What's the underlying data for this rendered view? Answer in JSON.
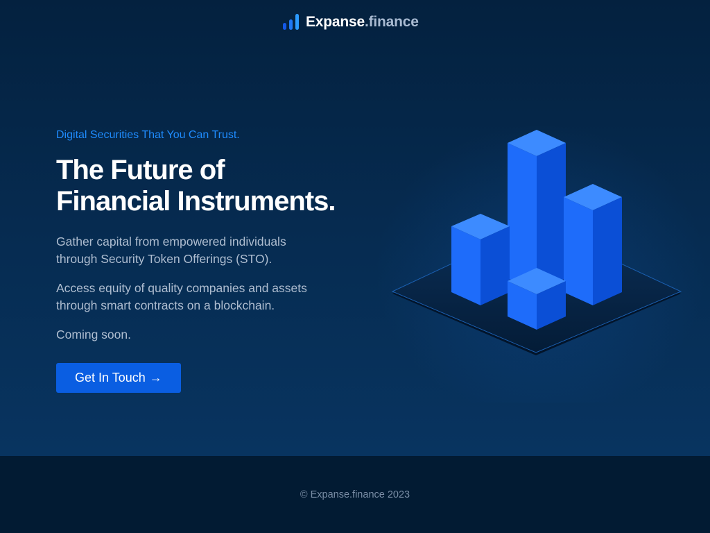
{
  "brand": {
    "name_primary": "Expanse",
    "name_secondary": ".finance",
    "logo_icon": "bar-chart-icon",
    "accent_color": "#1f8cff"
  },
  "hero": {
    "tagline": "Digital Securities That You Can Trust.",
    "headline": "The Future of\nFinancial Instruments.",
    "paragraphs": [
      "Gather capital from empowered individuals\nthrough Security Token Offerings (STO).",
      "Access equity of quality companies and assets\nthrough smart contracts on a blockchain.",
      "Coming soon."
    ],
    "cta_label": "Get In Touch",
    "cta_icon": "arrow-right-icon",
    "cta_arrow": "→",
    "cta_color": "#0a5ee2",
    "illustration_icon": "isometric-bar-chart-icon"
  },
  "footer": {
    "copyright": "© Expanse.finance 2023"
  }
}
